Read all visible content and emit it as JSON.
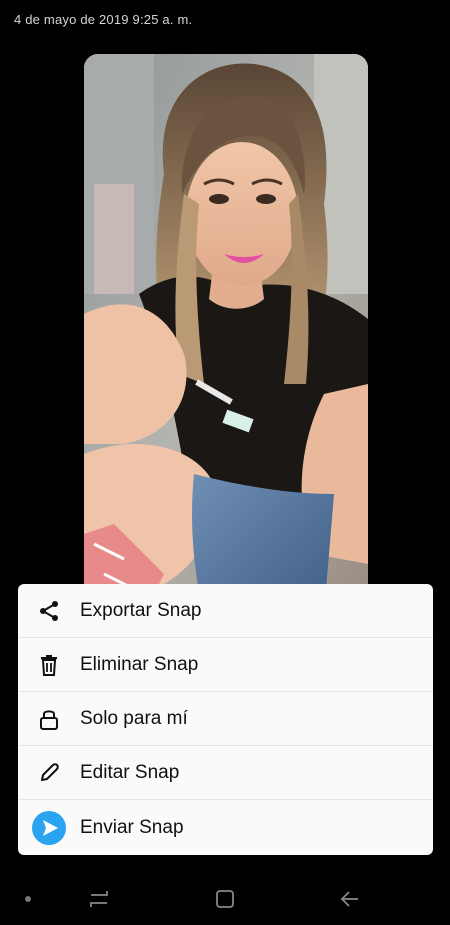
{
  "header": {
    "timestamp": "4 de mayo de 2019 9:25 a. m."
  },
  "photo": {
    "description_icon": "snap-photo"
  },
  "menu": {
    "items": [
      {
        "label": "Exportar Snap",
        "icon": "share-icon"
      },
      {
        "label": "Eliminar Snap",
        "icon": "trash-icon"
      },
      {
        "label": "Solo para mí",
        "icon": "lock-icon"
      },
      {
        "label": "Editar Snap",
        "icon": "pencil-icon"
      },
      {
        "label": "Enviar Snap",
        "icon": "send-icon"
      }
    ]
  },
  "navbar": {
    "buttons": [
      "recent-apps-icon",
      "home-icon",
      "back-icon"
    ]
  },
  "colors": {
    "background": "#000000",
    "menu_background": "#fafafa",
    "send_accent": "#2aa4f0",
    "text_dark": "#111111"
  }
}
